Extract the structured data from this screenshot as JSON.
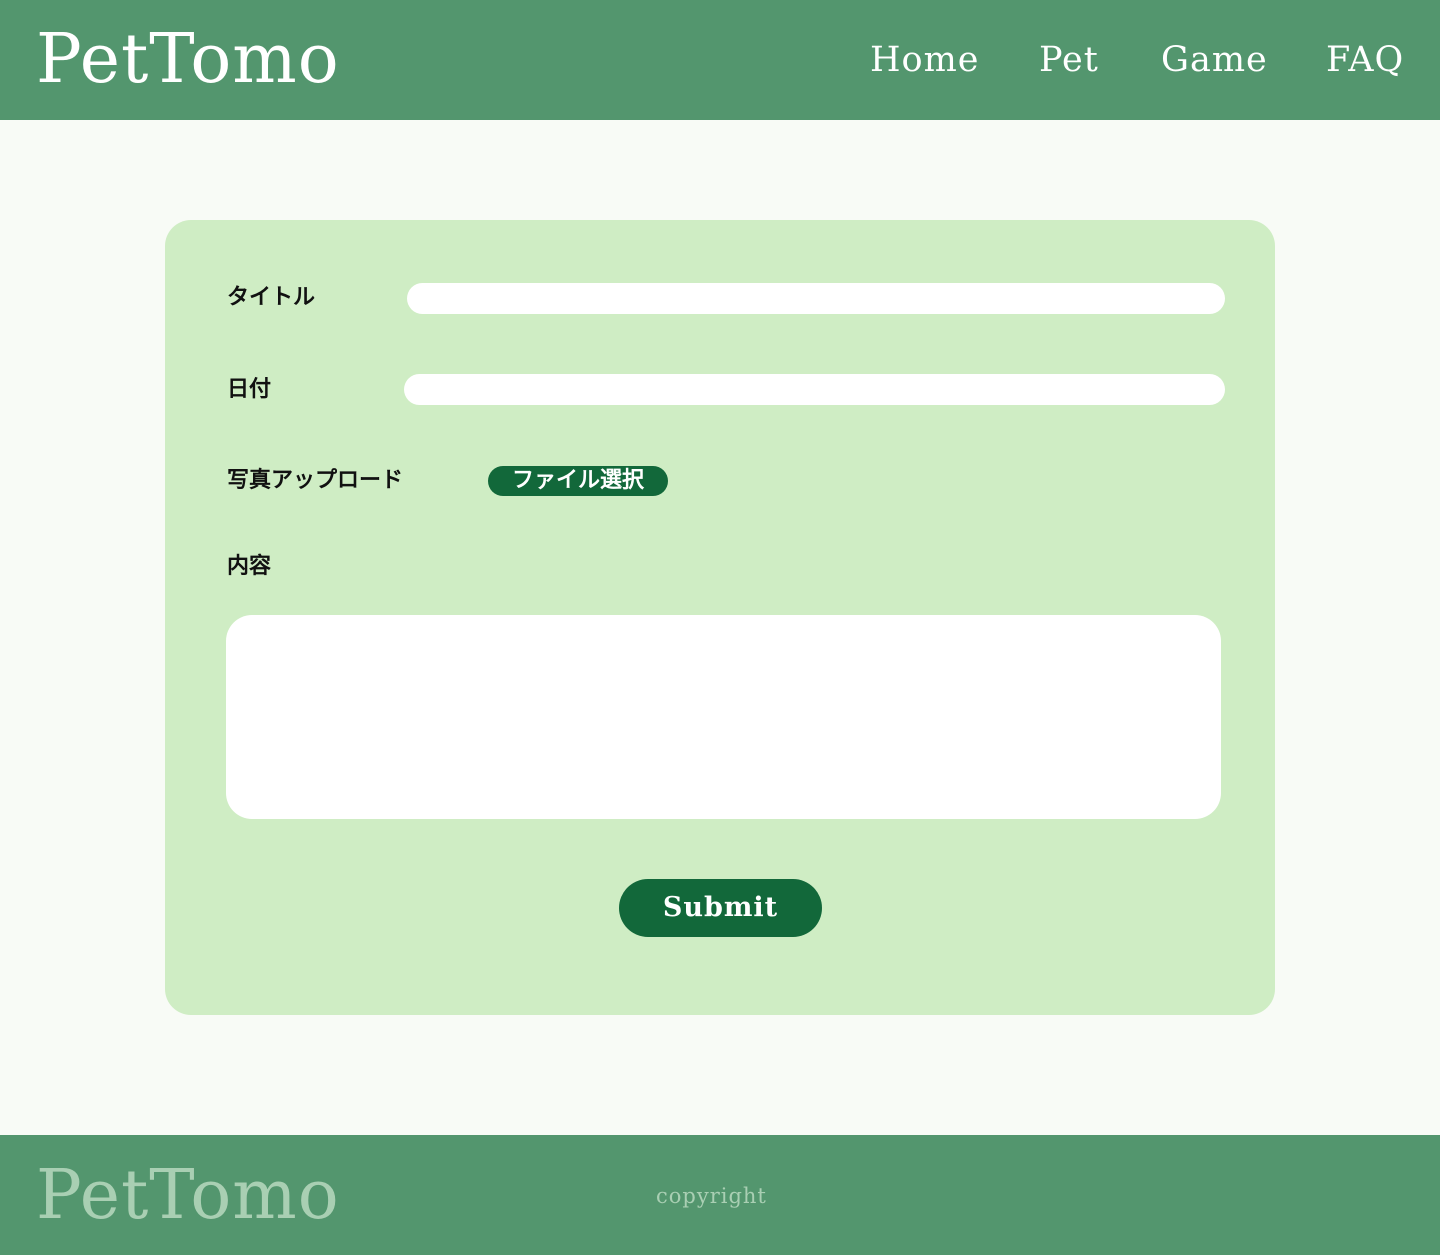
{
  "header": {
    "logo": "PetTomo",
    "nav": [
      {
        "label": "Home"
      },
      {
        "label": "Pet"
      },
      {
        "label": "Game"
      },
      {
        "label": "FAQ"
      }
    ]
  },
  "form": {
    "title_label": "タイトル",
    "title_value": "",
    "date_label": "日付",
    "date_value": "",
    "photo_label": "写真アップロード",
    "file_button_label": "ファイル選択",
    "content_label": "内容",
    "content_value": "",
    "submit_label": "Submit"
  },
  "footer": {
    "logo": "PetTomo",
    "copyright": "copyright"
  },
  "colors": {
    "header_bg": "#53966e",
    "page_bg": "#f8fbf6",
    "card_bg": "#cfedc4",
    "button_bg": "#12683a",
    "footer_logo": "#a9cfb3"
  }
}
